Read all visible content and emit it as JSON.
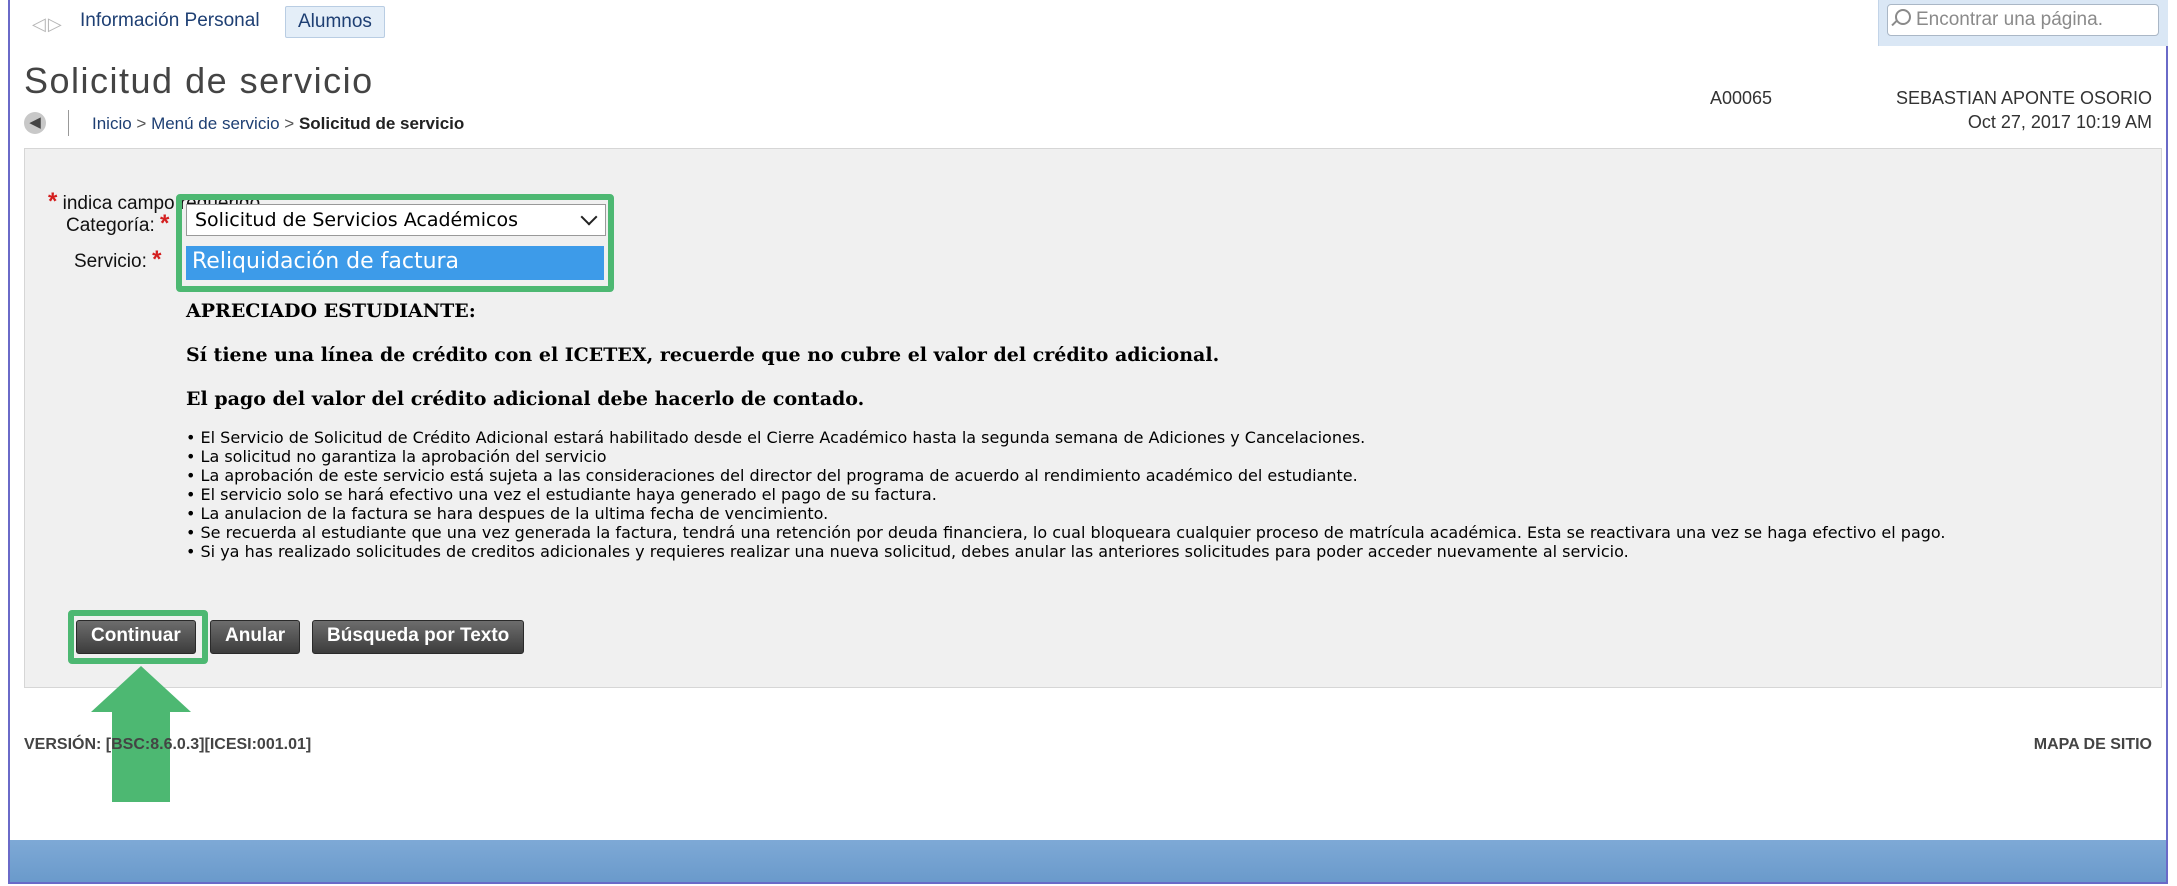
{
  "nav": {
    "arrows": "◁▷",
    "tab_info": "Información Personal",
    "tab_alumnos": "Alumnos",
    "search_placeholder": "Encontrar una página."
  },
  "page": {
    "title": "Solicitud de servicio",
    "breadcrumb": {
      "inicio": "Inicio",
      "sep": " > ",
      "menu": "Menú de servicio",
      "current": "Solicitud de servicio"
    },
    "user": {
      "id": "A00065",
      "name": "SEBASTIAN APONTE OSORIO",
      "datetime": "Oct 27, 2017 10:19 AM"
    }
  },
  "form": {
    "required_star": "*",
    "required_note": "indica campo requerido",
    "category_label": "Categoría:",
    "category_value": "Solicitud de Servicios Académicos",
    "service_label": "Servicio:",
    "service_value": "Reliquidación de factura"
  },
  "message": {
    "heading": "APRECIADO ESTUDIANTE:",
    "line2": "Sí tiene una línea de crédito con el ICETEX, recuerde que no cubre el valor del crédito adicional.",
    "line3": "El pago del valor del crédito adicional debe hacerlo de contado.",
    "bullets": [
      "• El Servicio de Solicitud de Crédito Adicional estará habilitado desde el Cierre Académico hasta la segunda semana de Adiciones y Cancelaciones.",
      "• La solicitud no garantiza la aprobación del servicio",
      "• La aprobación de este servicio está sujeta a las consideraciones del director del programa de acuerdo al rendimiento académico del estudiante.",
      "• El servicio solo se hará efectivo una vez el estudiante haya generado el pago de su factura.",
      "• La anulacion de la factura se hara despues de la ultima fecha de vencimiento.",
      "• Se recuerda al estudiante que una vez generada la factura, tendrá una retención por deuda financiera, lo cual bloqueara cualquier proceso de matrícula académica. Esta se reactivara una vez se haga efectivo el pago.",
      "• Si ya has realizado solicitudes de creditos adicionales y requieres realizar una nueva solicitud, debes anular las anteriores solicitudes para poder acceder nuevamente al servicio."
    ]
  },
  "buttons": {
    "continuar": "Continuar",
    "anular": "Anular",
    "busqueda": "Búsqueda por Texto"
  },
  "footer": {
    "version": "VERSIÓN: [BSC:8.6.0.3][ICESI:001.01]",
    "sitemap": "MAPA DE SITIO"
  },
  "colors": {
    "highlight": "#4db872",
    "selected": "#3d9be9",
    "required": "#d41f1f",
    "footer": "#7ea9d6"
  }
}
